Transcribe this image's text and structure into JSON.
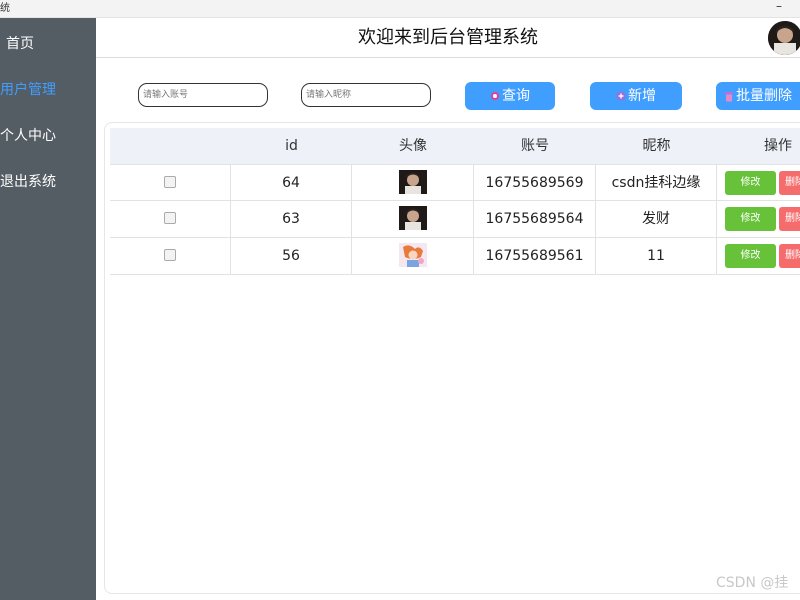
{
  "window": {
    "title_fragment": "统",
    "minimize": "–"
  },
  "sidebar": {
    "items": [
      {
        "label": "首页"
      },
      {
        "label": "用户管理"
      },
      {
        "label": "个人中心"
      },
      {
        "label": "退出系统"
      }
    ],
    "active_index": 1
  },
  "header": {
    "title": "欢迎来到后台管理系统"
  },
  "search": {
    "account_placeholder": "请输入账号",
    "nickname_placeholder": "请输入昵称",
    "query_label": "查询",
    "add_label": "新增",
    "batch_delete_label": "批量删除"
  },
  "table": {
    "columns": [
      "",
      "id",
      "头像",
      "账号",
      "昵称",
      "操作"
    ],
    "rows": [
      {
        "id": "64",
        "account": "16755689569",
        "nickname": "csdn挂科边缘",
        "edit": "修改",
        "delete": "删除"
      },
      {
        "id": "63",
        "account": "16755689564",
        "nickname": "发财",
        "edit": "修改",
        "delete": "删除"
      },
      {
        "id": "56",
        "account": "16755689561",
        "nickname": "11",
        "edit": "修改",
        "delete": "删除"
      }
    ]
  },
  "watermark": "CSDN @挂",
  "colors": {
    "sidebar_bg": "#545c64",
    "accent": "#409eff",
    "success": "#67c23a",
    "danger": "#f56c6c"
  }
}
